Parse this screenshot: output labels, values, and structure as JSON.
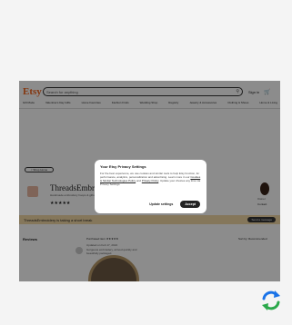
{
  "header": {
    "logo": "Etsy",
    "search_placeholder": "Search for anything",
    "search_icon": "search-icon",
    "signin": "Sign in",
    "cart_icon": "cart-icon"
  },
  "categories": [
    "Gift Mode",
    "Valentine's Day Gifts",
    "Home Favorites",
    "Fashion Finds",
    "Wedding Shop",
    "Registry",
    "Jewelry & Accessories",
    "Clothing & Shoes",
    "Home & Living"
  ],
  "shop": {
    "back_button": "< Shop Home",
    "name": "ThreadsEmbroidery",
    "description": "Handmade embroidery hoops & gifts",
    "location": "Oxford, UK",
    "rating_stars": "★★★★★",
    "owner_label": "Owner",
    "contact": "Contact"
  },
  "banner": {
    "text": "ThreadsEmbroidery is taking a short break",
    "button": "Send a message"
  },
  "reviews": {
    "heading": "Reviews",
    "sort": "Sort by: Recommended",
    "reviewer": "Purchased item",
    "stars": "★★★★★",
    "date": "Updated on Feb 17, 2024",
    "text": "Gorgeous embroidery, arrived quickly and beautifully packaged."
  },
  "modal": {
    "title": "Your Etsy Privacy Settings",
    "body_pre": "For the best experience, we use cookies and similar tools to help Etsy function, for performance, analytics, personalization and advertising. Learn more in our ",
    "cookie_link": "Cookies & Similar Technologies Policy",
    "body_mid": " and ",
    "privacy_link": "Privacy Policy",
    "body_post": ". Update your choices any time via Privacy Settings.",
    "update_button": "Update settings",
    "accept_button": "Accept"
  },
  "refresh_icon": "refresh-icon",
  "colors": {
    "etsy_orange": "#f1641e",
    "refresh_blue": "#1a73e8",
    "refresh_green": "#2aa84a"
  }
}
